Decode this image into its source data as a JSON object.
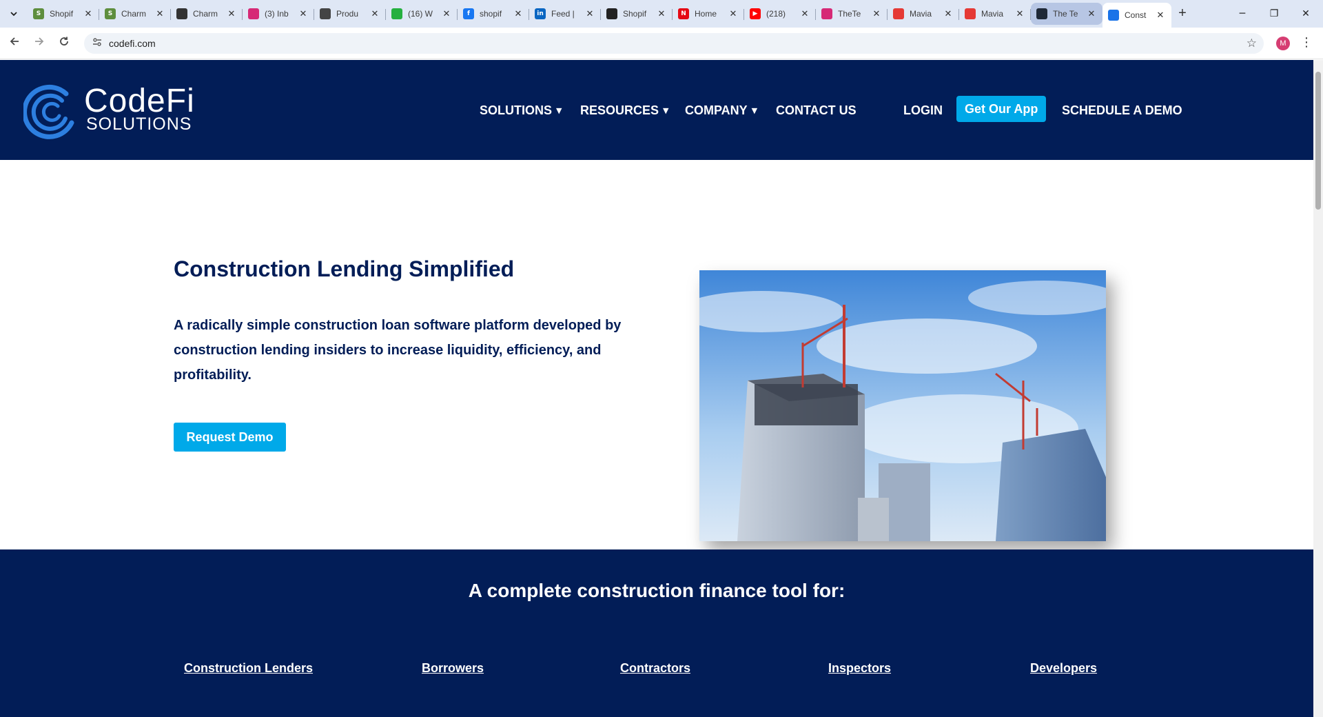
{
  "browser": {
    "tabs": [
      {
        "title": "Shopif",
        "fav": "S",
        "color": "#5e8e3e"
      },
      {
        "title": "Charm",
        "fav": "S",
        "color": "#5e8e3e"
      },
      {
        "title": "Charm",
        "fav": "",
        "color": "#333333"
      },
      {
        "title": "(3) Inb",
        "fav": "",
        "color": "#d62976"
      },
      {
        "title": "Produ",
        "fav": "",
        "color": "#444444"
      },
      {
        "title": "(16) W",
        "fav": "",
        "color": "#25b03f"
      },
      {
        "title": "shopif",
        "fav": "f",
        "color": "#1877f2"
      },
      {
        "title": "Feed |",
        "fav": "in",
        "color": "#0a66c2"
      },
      {
        "title": "Shopif",
        "fav": "",
        "color": "#222222"
      },
      {
        "title": "Home",
        "fav": "N",
        "color": "#e50914"
      },
      {
        "title": "(218)",
        "fav": "▶",
        "color": "#ff0000"
      },
      {
        "title": "TheTe",
        "fav": "",
        "color": "#d62976"
      },
      {
        "title": "Mavia",
        "fav": "",
        "color": "#e53935"
      },
      {
        "title": "Mavia",
        "fav": "",
        "color": "#e53935"
      },
      {
        "title": "The Te",
        "fav": "",
        "color": "#1f2937"
      },
      {
        "title": "Const",
        "fav": "",
        "color": "#1a73e8"
      }
    ],
    "url": "codefi.com",
    "profile_initial": "M"
  },
  "site": {
    "logo": {
      "word1": "CodeFi",
      "word2": "SOLUTIONS"
    },
    "nav": {
      "solutions": "SOLUTIONS",
      "resources": "RESOURCES",
      "company": "COMPANY",
      "contact": "CONTACT US",
      "login": "LOGIN",
      "get_app": "Get Our App",
      "schedule": "SCHEDULE A DEMO"
    },
    "hero": {
      "title": "Construction Lending Simplified",
      "text": "A radically simple construction loan software platform developed by construction lending insiders to increase liquidity, efficiency, and profitability.",
      "button": "Request Demo"
    },
    "features": {
      "title": "A complete construction finance tool for:",
      "audiences": [
        "Construction Lenders",
        "Borrowers",
        "Contractors",
        "Inspectors",
        "Developers"
      ]
    }
  },
  "colors": {
    "navy": "#021d57",
    "accent": "#00a9e9"
  }
}
